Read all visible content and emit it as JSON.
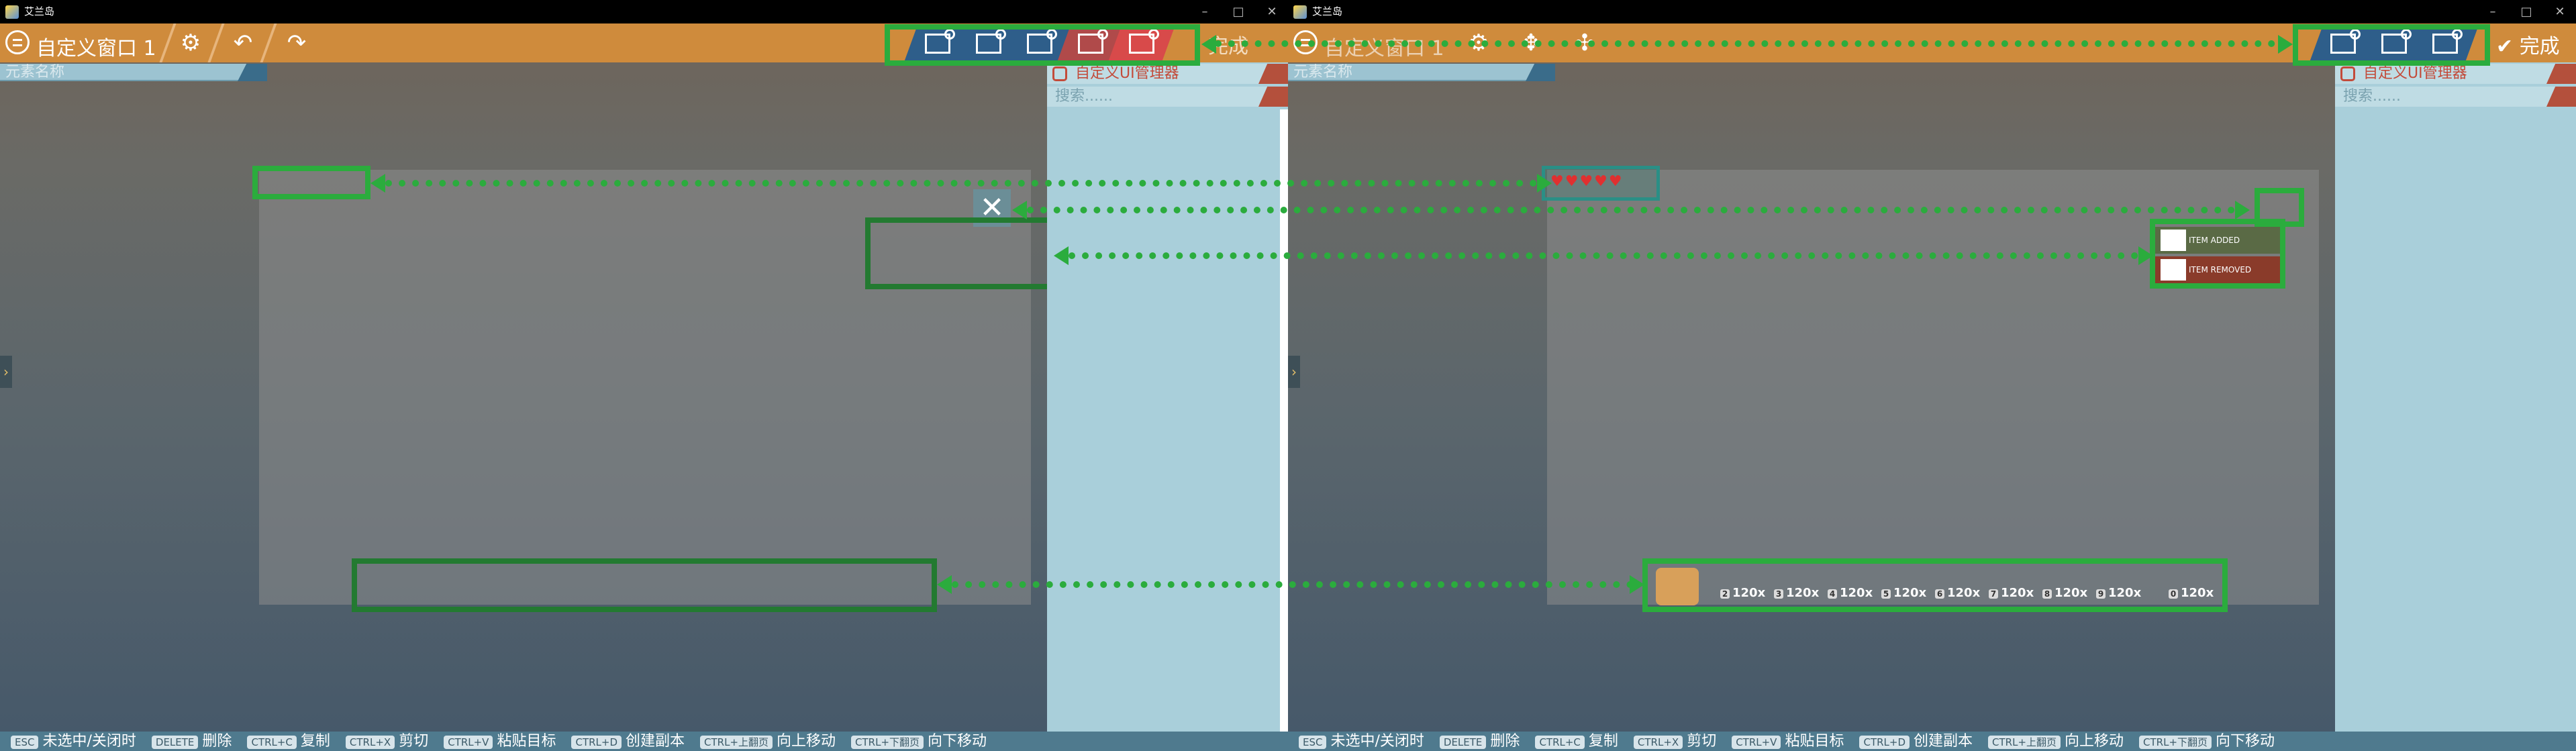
{
  "window": {
    "title": "艾兰岛",
    "minimize": "–",
    "maximize": "□",
    "close": "✕"
  },
  "left": {
    "toolbar_title": "自定义窗口 1",
    "done_label": "完成",
    "element_search_placeholder": "元素名称",
    "manager_title": "自定义UI管理器",
    "manager_search_placeholder": "搜索......",
    "close_glyph": "✕"
  },
  "right": {
    "toolbar_title": "自定义窗口 1",
    "done_label": "完成",
    "element_search_placeholder": "元素名称",
    "manager_title": "自定义UI管理器",
    "manager_search_placeholder": "搜索......",
    "hearts": "♥♥♥♥♥",
    "notifications": [
      {
        "count": "1",
        "label": "ITEM ADDED",
        "color": "#5a6a45"
      },
      {
        "count": "1",
        "label": "ITEM REMOVED",
        "color": "#8a3b2a"
      }
    ],
    "hotbar": [
      {
        "num": "1",
        "qty": ""
      },
      {
        "num": "2",
        "qty": "120x"
      },
      {
        "num": "3",
        "qty": "120x"
      },
      {
        "num": "4",
        "qty": "120x"
      },
      {
        "num": "5",
        "qty": "120x"
      },
      {
        "num": "6",
        "qty": "120x"
      },
      {
        "num": "7",
        "qty": "120x"
      },
      {
        "num": "8",
        "qty": "120x"
      },
      {
        "num": "9",
        "qty": "120x"
      },
      {
        "num": "0",
        "qty": "120x"
      }
    ]
  },
  "shortcuts": [
    {
      "key": "ESC",
      "label": "未选中/关闭时"
    },
    {
      "key": "DELETE",
      "label": "删除"
    },
    {
      "key": "CTRL+C",
      "label": "复制"
    },
    {
      "key": "CTRL+X",
      "label": "剪切"
    },
    {
      "key": "CTRL+V",
      "label": "粘贴目标"
    },
    {
      "key": "CTRL+D",
      "label": "创建副本"
    },
    {
      "key": "CTRL+上翻页",
      "label": "向上移动"
    },
    {
      "key": "CTRL+下翻页",
      "label": "向下移动"
    }
  ],
  "colors": {
    "toolbar": "#cf8b3c",
    "highlight_green": "#2bac3d",
    "panel": "#a9cfda",
    "bottombar": "#4f7a8e"
  }
}
